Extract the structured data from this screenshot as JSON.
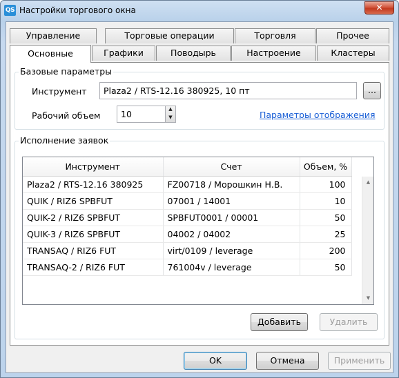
{
  "window": {
    "icon_text": "QS",
    "title": "Настройки торгового окна",
    "close_glyph": "✕"
  },
  "tabs_row1": [
    "Управление",
    "Торговые операции",
    "Торговля",
    "Прочее"
  ],
  "tabs_row2": [
    "Основные",
    "Графики",
    "Поводырь",
    "Настроение",
    "Кластеры"
  ],
  "active_tab": "Основные",
  "base_params": {
    "group_label": "Базовые параметры",
    "instrument_label": "Инструмент",
    "instrument_value": "Plaza2 / RTS-12.16 380925, 10 пт",
    "browse_label": "...",
    "volume_label": "Рабочий объем",
    "volume_value": "10",
    "display_params_link": "Параметры отображения"
  },
  "orders": {
    "group_label": "Исполнение заявок",
    "columns": [
      "Инструмент",
      "Счет",
      "Объем, %"
    ],
    "rows": [
      {
        "instrument": "Plaza2 / RTS-12.16 380925",
        "account": "FZ00718 / Морошкин Н.В.",
        "volume": "100"
      },
      {
        "instrument": "QUIK / RIZ6 SPBFUT",
        "account": "07001 / 14001",
        "volume": "10"
      },
      {
        "instrument": "QUIK-2 / RIZ6 SPBFUT",
        "account": "SPBFUT0001 / 00001",
        "volume": "50"
      },
      {
        "instrument": "QUIK-3 / RIZ6 SPBFUT",
        "account": "04002 / 04002",
        "volume": "25"
      },
      {
        "instrument": "TRANSAQ / RIZ6 FUT",
        "account": "virt/0109 / leverage",
        "volume": "200"
      },
      {
        "instrument": "TRANSAQ-2 / RIZ6 FUT",
        "account": "761004v / leverage",
        "volume": "50"
      }
    ],
    "add_label": "Добавить",
    "delete_label": "Удалить"
  },
  "footer": {
    "ok_label": "OK",
    "cancel_label": "Отмена",
    "apply_label": "Применить"
  },
  "icons": {
    "scroll_up": "▲",
    "scroll_down": "▼",
    "spin_up": "▲",
    "spin_down": "▼"
  }
}
